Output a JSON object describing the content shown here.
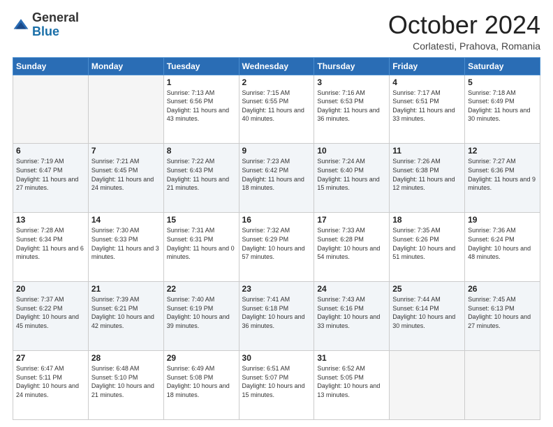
{
  "header": {
    "logo": {
      "general": "General",
      "blue": "Blue"
    },
    "title": "October 2024",
    "location": "Corlatesti, Prahova, Romania"
  },
  "days_of_week": [
    "Sunday",
    "Monday",
    "Tuesday",
    "Wednesday",
    "Thursday",
    "Friday",
    "Saturday"
  ],
  "weeks": [
    [
      {
        "day": "",
        "empty": true
      },
      {
        "day": "",
        "empty": true
      },
      {
        "day": "1",
        "sunrise": "Sunrise: 7:13 AM",
        "sunset": "Sunset: 6:56 PM",
        "daylight": "Daylight: 11 hours and 43 minutes."
      },
      {
        "day": "2",
        "sunrise": "Sunrise: 7:15 AM",
        "sunset": "Sunset: 6:55 PM",
        "daylight": "Daylight: 11 hours and 40 minutes."
      },
      {
        "day": "3",
        "sunrise": "Sunrise: 7:16 AM",
        "sunset": "Sunset: 6:53 PM",
        "daylight": "Daylight: 11 hours and 36 minutes."
      },
      {
        "day": "4",
        "sunrise": "Sunrise: 7:17 AM",
        "sunset": "Sunset: 6:51 PM",
        "daylight": "Daylight: 11 hours and 33 minutes."
      },
      {
        "day": "5",
        "sunrise": "Sunrise: 7:18 AM",
        "sunset": "Sunset: 6:49 PM",
        "daylight": "Daylight: 11 hours and 30 minutes."
      }
    ],
    [
      {
        "day": "6",
        "sunrise": "Sunrise: 7:19 AM",
        "sunset": "Sunset: 6:47 PM",
        "daylight": "Daylight: 11 hours and 27 minutes."
      },
      {
        "day": "7",
        "sunrise": "Sunrise: 7:21 AM",
        "sunset": "Sunset: 6:45 PM",
        "daylight": "Daylight: 11 hours and 24 minutes."
      },
      {
        "day": "8",
        "sunrise": "Sunrise: 7:22 AM",
        "sunset": "Sunset: 6:43 PM",
        "daylight": "Daylight: 11 hours and 21 minutes."
      },
      {
        "day": "9",
        "sunrise": "Sunrise: 7:23 AM",
        "sunset": "Sunset: 6:42 PM",
        "daylight": "Daylight: 11 hours and 18 minutes."
      },
      {
        "day": "10",
        "sunrise": "Sunrise: 7:24 AM",
        "sunset": "Sunset: 6:40 PM",
        "daylight": "Daylight: 11 hours and 15 minutes."
      },
      {
        "day": "11",
        "sunrise": "Sunrise: 7:26 AM",
        "sunset": "Sunset: 6:38 PM",
        "daylight": "Daylight: 11 hours and 12 minutes."
      },
      {
        "day": "12",
        "sunrise": "Sunrise: 7:27 AM",
        "sunset": "Sunset: 6:36 PM",
        "daylight": "Daylight: 11 hours and 9 minutes."
      }
    ],
    [
      {
        "day": "13",
        "sunrise": "Sunrise: 7:28 AM",
        "sunset": "Sunset: 6:34 PM",
        "daylight": "Daylight: 11 hours and 6 minutes."
      },
      {
        "day": "14",
        "sunrise": "Sunrise: 7:30 AM",
        "sunset": "Sunset: 6:33 PM",
        "daylight": "Daylight: 11 hours and 3 minutes."
      },
      {
        "day": "15",
        "sunrise": "Sunrise: 7:31 AM",
        "sunset": "Sunset: 6:31 PM",
        "daylight": "Daylight: 11 hours and 0 minutes."
      },
      {
        "day": "16",
        "sunrise": "Sunrise: 7:32 AM",
        "sunset": "Sunset: 6:29 PM",
        "daylight": "Daylight: 10 hours and 57 minutes."
      },
      {
        "day": "17",
        "sunrise": "Sunrise: 7:33 AM",
        "sunset": "Sunset: 6:28 PM",
        "daylight": "Daylight: 10 hours and 54 minutes."
      },
      {
        "day": "18",
        "sunrise": "Sunrise: 7:35 AM",
        "sunset": "Sunset: 6:26 PM",
        "daylight": "Daylight: 10 hours and 51 minutes."
      },
      {
        "day": "19",
        "sunrise": "Sunrise: 7:36 AM",
        "sunset": "Sunset: 6:24 PM",
        "daylight": "Daylight: 10 hours and 48 minutes."
      }
    ],
    [
      {
        "day": "20",
        "sunrise": "Sunrise: 7:37 AM",
        "sunset": "Sunset: 6:22 PM",
        "daylight": "Daylight: 10 hours and 45 minutes."
      },
      {
        "day": "21",
        "sunrise": "Sunrise: 7:39 AM",
        "sunset": "Sunset: 6:21 PM",
        "daylight": "Daylight: 10 hours and 42 minutes."
      },
      {
        "day": "22",
        "sunrise": "Sunrise: 7:40 AM",
        "sunset": "Sunset: 6:19 PM",
        "daylight": "Daylight: 10 hours and 39 minutes."
      },
      {
        "day": "23",
        "sunrise": "Sunrise: 7:41 AM",
        "sunset": "Sunset: 6:18 PM",
        "daylight": "Daylight: 10 hours and 36 minutes."
      },
      {
        "day": "24",
        "sunrise": "Sunrise: 7:43 AM",
        "sunset": "Sunset: 6:16 PM",
        "daylight": "Daylight: 10 hours and 33 minutes."
      },
      {
        "day": "25",
        "sunrise": "Sunrise: 7:44 AM",
        "sunset": "Sunset: 6:14 PM",
        "daylight": "Daylight: 10 hours and 30 minutes."
      },
      {
        "day": "26",
        "sunrise": "Sunrise: 7:45 AM",
        "sunset": "Sunset: 6:13 PM",
        "daylight": "Daylight: 10 hours and 27 minutes."
      }
    ],
    [
      {
        "day": "27",
        "sunrise": "Sunrise: 6:47 AM",
        "sunset": "Sunset: 5:11 PM",
        "daylight": "Daylight: 10 hours and 24 minutes."
      },
      {
        "day": "28",
        "sunrise": "Sunrise: 6:48 AM",
        "sunset": "Sunset: 5:10 PM",
        "daylight": "Daylight: 10 hours and 21 minutes."
      },
      {
        "day": "29",
        "sunrise": "Sunrise: 6:49 AM",
        "sunset": "Sunset: 5:08 PM",
        "daylight": "Daylight: 10 hours and 18 minutes."
      },
      {
        "day": "30",
        "sunrise": "Sunrise: 6:51 AM",
        "sunset": "Sunset: 5:07 PM",
        "daylight": "Daylight: 10 hours and 15 minutes."
      },
      {
        "day": "31",
        "sunrise": "Sunrise: 6:52 AM",
        "sunset": "Sunset: 5:05 PM",
        "daylight": "Daylight: 10 hours and 13 minutes."
      },
      {
        "day": "",
        "empty": true
      },
      {
        "day": "",
        "empty": true
      }
    ]
  ]
}
